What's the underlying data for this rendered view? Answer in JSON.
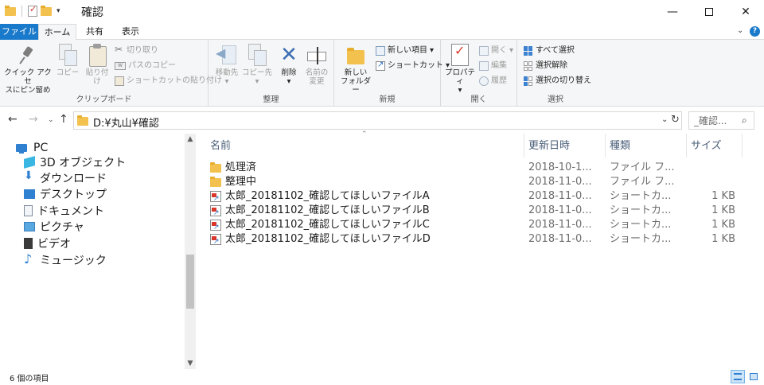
{
  "window": {
    "title": "確認",
    "minimize": "—",
    "maximize": "",
    "close": "✕"
  },
  "ribbon_tabs": {
    "file": "ファイル",
    "home": "ホーム",
    "share": "共有",
    "view": "表示",
    "help": "?"
  },
  "clipboard": {
    "pin_quick_access": [
      "クイック アクセ",
      "スにピン留め"
    ],
    "copy": "コピー",
    "paste": "貼り付け",
    "cut": "切り取り",
    "copy_path": "パスのコピー",
    "paste_shortcut": "ショートカットの貼り付け",
    "group_label": "クリップボード"
  },
  "organize": {
    "move_to": "移動先",
    "copy_to": "コピー先",
    "delete": "削除",
    "rename": [
      "名前の",
      "変更"
    ],
    "group_label": "整理"
  },
  "new": {
    "new_folder": [
      "新しい",
      "フォルダー"
    ],
    "new_item": "新しい項目",
    "shortcut": "ショートカット",
    "group_label": "新規"
  },
  "open": {
    "properties": "プロパティ",
    "open": "開く",
    "edit": "編集",
    "history": "履歴",
    "group_label": "開く"
  },
  "select": {
    "select_all": "すべて選択",
    "select_none": "選択解除",
    "invert": "選択の切り替え",
    "group_label": "選択"
  },
  "address": {
    "path": "D:¥丸山¥確認",
    "search_placeholder": "_確認..."
  },
  "nav_pane": {
    "root": "PC",
    "items": [
      "3D オブジェクト",
      "ダウンロード",
      "デスクトップ",
      "ドキュメント",
      "ピクチャ",
      "ビデオ",
      "ミュージック"
    ]
  },
  "columns": {
    "name": "名前",
    "date": "更新日時",
    "type": "種類",
    "size": "サイズ"
  },
  "files": [
    {
      "name": "処理済",
      "date": "2018-10-1...",
      "type": "ファイル フ...",
      "size": "",
      "kind": "folder"
    },
    {
      "name": "整理中",
      "date": "2018-11-0...",
      "type": "ファイル フ...",
      "size": "",
      "kind": "folder"
    },
    {
      "name": "太郎_20181102_確認してほしいファイルA",
      "date": "2018-11-0...",
      "type": "ショートカ...",
      "size": "1 KB",
      "kind": "shortcut"
    },
    {
      "name": "太郎_20181102_確認してほしいファイルB",
      "date": "2018-11-0...",
      "type": "ショートカ...",
      "size": "1 KB",
      "kind": "shortcut"
    },
    {
      "name": "太郎_20181102_確認してほしいファイルC",
      "date": "2018-11-0...",
      "type": "ショートカ...",
      "size": "1 KB",
      "kind": "shortcut"
    },
    {
      "name": "太郎_20181102_確認してほしいファイルD",
      "date": "2018-11-0...",
      "type": "ショートカ...",
      "size": "1 KB",
      "kind": "shortcut"
    }
  ],
  "status": {
    "item_count": "6 個の項目"
  },
  "colors": {
    "accent": "#1979ca",
    "folder": "#f2c14e",
    "ribbon_bg": "#f5f6f7"
  }
}
